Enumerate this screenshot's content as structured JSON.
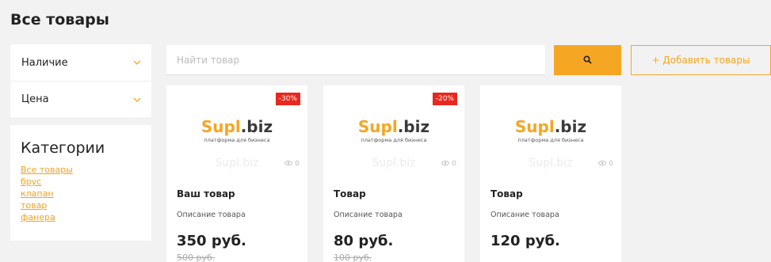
{
  "page": {
    "title": "Все товары"
  },
  "filters": [
    {
      "label": "Наличие",
      "icon": "chevron-down-icon"
    },
    {
      "label": "Цена",
      "icon": "chevron-down-icon"
    }
  ],
  "categories": {
    "title": "Категории",
    "items": [
      "Все товары",
      "брус",
      "клапан",
      "товар",
      "фанера"
    ]
  },
  "search": {
    "placeholder": "Найти товар",
    "value": "",
    "icon": "search-icon"
  },
  "add_button": {
    "label": "+ Добавить товары"
  },
  "brand": {
    "logo_part1": "Supl",
    "logo_part2": ".biz",
    "tagline": "платформа для бизнеса",
    "watermark": "Supl.biz"
  },
  "colors": {
    "accent": "#f5a623",
    "badge": "#e8281e",
    "link": "#f0a21e"
  },
  "products": [
    {
      "name": "Ваш товар",
      "description": "Описание товара",
      "price": "350 руб.",
      "old_price": "500 руб.",
      "discount": "-30%",
      "views": "0"
    },
    {
      "name": "Товар",
      "description": "Описание товара",
      "price": "80 руб.",
      "old_price": "100 руб.",
      "discount": "-20%",
      "views": "0"
    },
    {
      "name": "Товар",
      "description": "Описание товара",
      "price": "120 руб.",
      "old_price": "",
      "discount": "",
      "views": "0"
    }
  ]
}
